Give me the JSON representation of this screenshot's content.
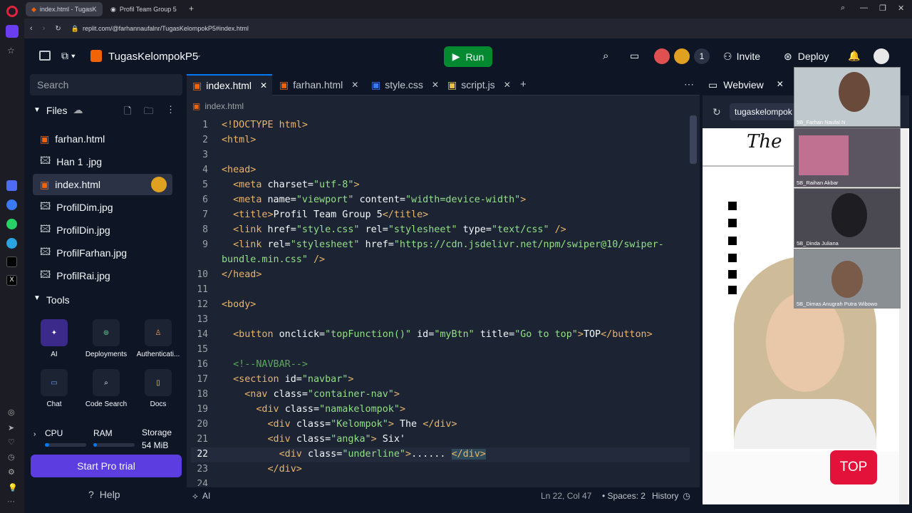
{
  "browser": {
    "tabs": [
      {
        "label": "index.html - TugasKelom..."
      },
      {
        "label": "Profil Team Group 5"
      }
    ],
    "url": "replit.com/@farhannaufalnr/TugasKelompokP5#index.html"
  },
  "top": {
    "project": "TugasKelompokP5",
    "run": "Run",
    "user_count": "1",
    "invite": "Invite",
    "deploy": "Deploy"
  },
  "sidebar": {
    "search_placeholder": "Search",
    "files_label": "Files",
    "files": [
      "farhan.html",
      "Han 1 .jpg",
      "index.html",
      "ProfilDim.jpg",
      "ProfilDin.jpg",
      "ProfilFarhan.jpg",
      "ProfilRai.jpg"
    ],
    "tools_label": "Tools",
    "tools": [
      "AI",
      "Deployments",
      "Authenticati...",
      "Chat",
      "Code Search",
      "Docs"
    ],
    "cpu": "CPU",
    "ram": "RAM",
    "storage": "Storage",
    "storage_value": "54 MiB",
    "pro_trial": "Start Pro trial",
    "help": "Help"
  },
  "editor": {
    "tabs": [
      "index.html",
      "farhan.html",
      "style.css",
      "script.js"
    ],
    "breadcrumb": "index.html",
    "status_ai": "AI",
    "cursor": "Ln 22, Col 47",
    "spaces": "Spaces: 2",
    "history": "History"
  },
  "webview": {
    "title": "Webview",
    "url": "tugaskelompok",
    "top_button": "TOP"
  },
  "video": [
    "5B_Farhan Naufal N",
    "5B_Raihan Akbar",
    "5B_Dinda Juliana",
    "5B_Dimas Anugrah Putra Wibowo"
  ]
}
